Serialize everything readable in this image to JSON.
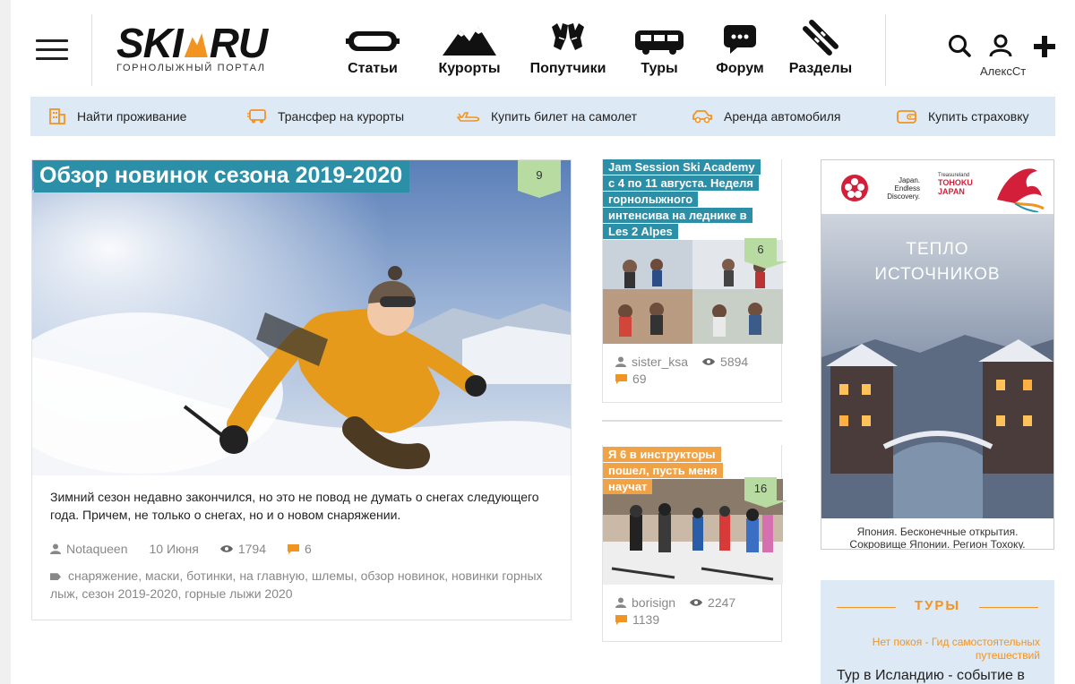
{
  "header": {
    "logo": {
      "text_left": "SKI",
      "text_right": "RU",
      "subtitle": "ГОРНОЛЫЖНЫЙ ПОРТАЛ"
    },
    "nav": [
      {
        "label": "Статьи",
        "icon": "goggles-icon"
      },
      {
        "label": "Курорты",
        "icon": "mountains-icon"
      },
      {
        "label": "Попутчики",
        "icon": "gloves-icon"
      },
      {
        "label": "Туры",
        "icon": "bus-icon"
      },
      {
        "label": "Форум",
        "icon": "chat-icon"
      },
      {
        "label": "Разделы",
        "icon": "skis-icon"
      }
    ],
    "user_name": "АлексСт"
  },
  "services": [
    {
      "label": "Найти проживание",
      "icon": "building-icon"
    },
    {
      "label": "Трансфер на курорты",
      "icon": "transfer-bus-icon"
    },
    {
      "label": "Купить билет на самолет",
      "icon": "plane-icon"
    },
    {
      "label": "Аренда автомобиля",
      "icon": "car-icon"
    },
    {
      "label": "Купить страховку",
      "icon": "wallet-icon"
    }
  ],
  "main_article": {
    "title": "Обзор новинок сезона 2019-2020",
    "comments_badge": "9",
    "description": "Зимний сезон недавно закончился, но это не повод не думать о снегах следующего года. Причем, не только о снегах, но и о новом снаряжении.",
    "author": "Notaqueen",
    "date": "10 Июня",
    "views": "1794",
    "comments": "6",
    "tags": [
      "снаряжение",
      "маски",
      "ботинки",
      "на главную",
      "шлемы",
      "обзор новинок",
      "новинки горных лыж",
      "сезон 2019-2020",
      "горные лыжи 2020"
    ]
  },
  "side_articles": [
    {
      "title": "Jam Session Ski Academy с 4 по 11 августа. Неделя горнолыжного интенсива на леднике в Les 2 Alpes",
      "badge": "6",
      "author": "sister_ksa",
      "views": "5894",
      "comments": "69",
      "color": "#2c8fa8"
    },
    {
      "title": "Я 6 в инструкторы пошел, пусть меня научат",
      "badge": "16",
      "author": "borisign",
      "views": "2247",
      "comments": "1139",
      "color": "#f0a247"
    }
  ],
  "ad": {
    "logo_left": "Japan. Endless Discovery.",
    "logo_right_top": "Treasureland",
    "logo_right": "TOHOKU JAPAN",
    "headline_1": "ТЕПЛО",
    "headline_2": "ИСТОЧНИКОВ",
    "caption_1": "Япония. Бесконечные открытия.",
    "caption_2": "Сокровище Японии. Регион Тохоку."
  },
  "tours": {
    "heading": "ТУРЫ",
    "subtitle": "Нет покоя - Гид самостоятельных путешествий",
    "item": "Тур в Исландию - событие в"
  },
  "colors": {
    "accent_orange": "#f29422",
    "title_teal": "#2c8fa8",
    "badge_green": "#b7dba1",
    "service_bg": "#dde9f4"
  }
}
